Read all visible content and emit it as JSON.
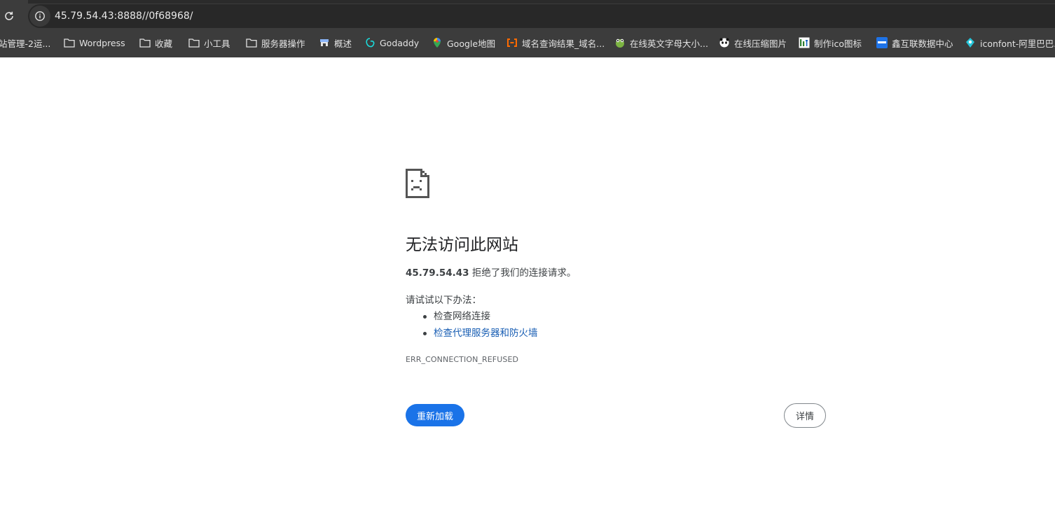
{
  "browser": {
    "url": "45.79.54.43:8888//0f68968/",
    "bookmarks": [
      {
        "label": "站管理-2运...",
        "icon": "partial-favicon"
      },
      {
        "label": "Wordpress",
        "icon": "folder-icon"
      },
      {
        "label": "收藏",
        "icon": "folder-icon"
      },
      {
        "label": "小工具",
        "icon": "folder-icon"
      },
      {
        "label": "服务器操作",
        "icon": "folder-icon"
      },
      {
        "label": "概述",
        "icon": "store-icon"
      },
      {
        "label": "Godaddy",
        "icon": "godaddy-icon"
      },
      {
        "label": "Google地图",
        "icon": "maps-pin-icon"
      },
      {
        "label": "域名查询结果_域名...",
        "icon": "aliyun-icon"
      },
      {
        "label": "在线英文字母大小...",
        "icon": "frog-icon"
      },
      {
        "label": "在线压缩图片",
        "icon": "panda-icon"
      },
      {
        "label": "制作ico图标",
        "icon": "bitbug-icon"
      },
      {
        "label": "鑫互联数据中心",
        "icon": "dsm-icon"
      },
      {
        "label": "iconfont-阿里巴巴...",
        "icon": "iconfont-icon"
      }
    ]
  },
  "error_page": {
    "icon": "sad-page-icon",
    "title": "无法访问此网站",
    "host": "45.79.54.43",
    "message": "拒绝了我们的连接请求。",
    "try_label": "请试试以下办法：",
    "suggestions": [
      {
        "text": "检查网络连接",
        "link": false
      },
      {
        "text": "检查代理服务器和防火墙",
        "link": true
      }
    ],
    "error_code": "ERR_CONNECTION_REFUSED",
    "reload_label": "重新加载",
    "details_label": "详情"
  },
  "colors": {
    "chrome_bg": "#3c3c3c",
    "address_bg": "#282828",
    "primary_button": "#1a73e8",
    "link": "#1a5fb4"
  }
}
